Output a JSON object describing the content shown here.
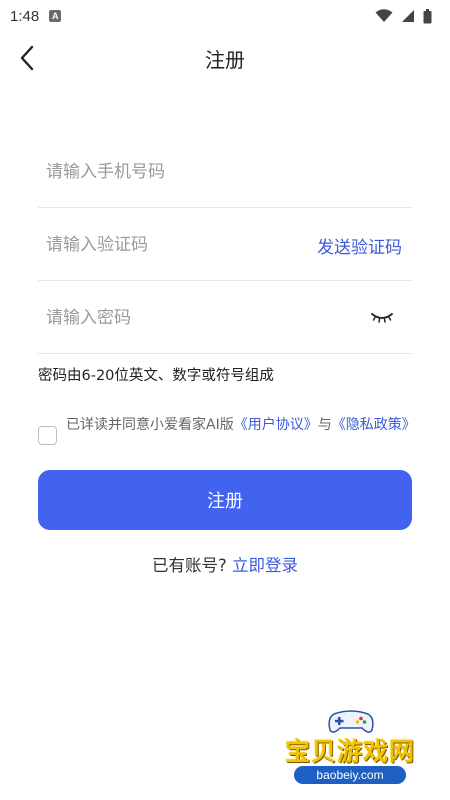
{
  "status_bar": {
    "time": "1:48",
    "notification_icon": "A",
    "icons": [
      "wifi-icon",
      "cellular-icon",
      "battery-icon"
    ]
  },
  "header": {
    "title": "注册",
    "back_icon": "chevron-left-icon"
  },
  "form": {
    "phone_placeholder": "请输入手机号码",
    "code_placeholder": "请输入验证码",
    "send_code_label": "发送验证码",
    "password_placeholder": "请输入密码",
    "password_toggle_icon": "eye-closed-icon",
    "password_hint": "密码由6-20位英文、数字或符号组成"
  },
  "agreement": {
    "checked": false,
    "prefix": "已详读并同意小爱看家AI版",
    "user_agreement": "《用户协议》",
    "connector": "与",
    "privacy_policy": "《隐私政策》"
  },
  "register_button_label": "注册",
  "login_prompt": {
    "question": "已有账号?",
    "link": "立即登录"
  },
  "watermark": {
    "title": "宝贝游戏网",
    "url": "baobeiy.com"
  },
  "colors": {
    "primary": "#4163f0",
    "link": "#3b5bdb",
    "placeholder": "#9a9a9a",
    "divider": "#e6e6e6"
  }
}
